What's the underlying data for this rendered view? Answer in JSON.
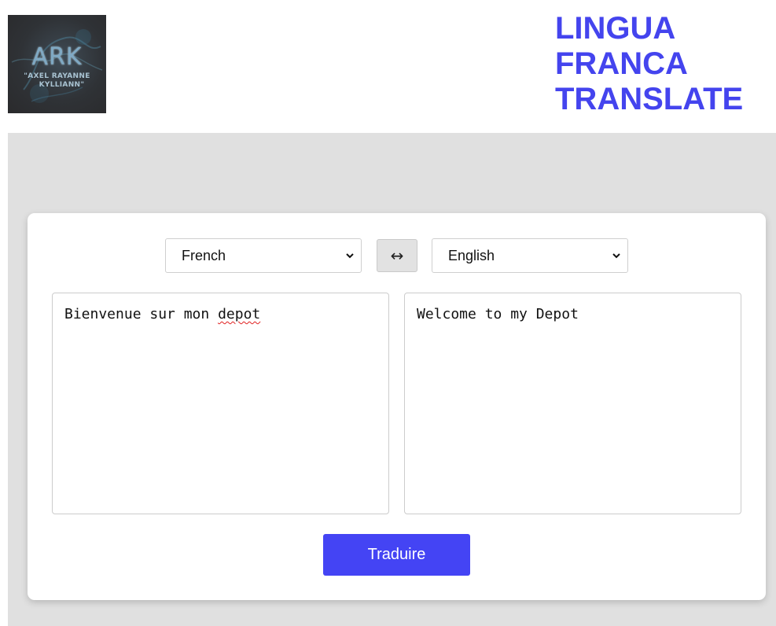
{
  "logo": {
    "main": "ARK",
    "line1": "\"AXEL RAYANNE",
    "line2": "KYLLIANN\""
  },
  "brand": {
    "lines": [
      "LINGUA",
      "FRANCA",
      "TRANSLATE"
    ],
    "color": "#4444ee"
  },
  "translator": {
    "source_language": "French",
    "target_language": "English",
    "swap_symbol": "↔",
    "source_text_before": "Bienvenue sur mon ",
    "source_text_flagged": "depot",
    "target_text": "Welcome to my Depot",
    "translate_label": "Traduire",
    "button_color": "#4444f4"
  },
  "icons": {
    "dropdown": "chevron-down-icon",
    "swap": "swap-arrows-icon"
  }
}
